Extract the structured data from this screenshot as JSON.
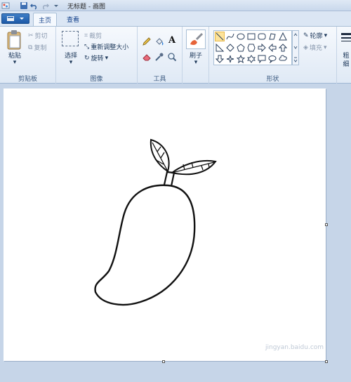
{
  "title_bar": {
    "title": "无标题 - 画图",
    "qat_icons": [
      "save-icon",
      "undo-icon",
      "redo-icon",
      "customize-qat-icon"
    ]
  },
  "tabs": [
    {
      "label": "主页",
      "active": true
    },
    {
      "label": "查看",
      "active": false
    }
  ],
  "ribbon": {
    "clipboard": {
      "group_label": "剪贴板",
      "paste_label": "粘贴",
      "cut_label": "剪切",
      "copy_label": "复制"
    },
    "image": {
      "group_label": "图像",
      "select_label": "选择",
      "crop_label": "裁剪",
      "resize_label": "重新调整大小",
      "rotate_label": "旋转"
    },
    "tools": {
      "group_label": "工具",
      "items": [
        "pencil-icon",
        "fill-icon",
        "text-icon",
        "eraser-icon",
        "color-picker-icon",
        "magnifier-icon"
      ]
    },
    "brushes": {
      "label": "刷子"
    },
    "shapes": {
      "group_label": "形状",
      "outline_label": "轮廓",
      "fill_label": "填充"
    },
    "size": {
      "label_partial_1": "粗",
      "label_partial_2": "细"
    }
  },
  "watermark": "jingyan.baidu.com",
  "colors": {
    "accent": "#1c59a7",
    "ribbon_bg": "#eef3fa",
    "workspace": "#c6d5e8",
    "selection": "#fde39a"
  }
}
